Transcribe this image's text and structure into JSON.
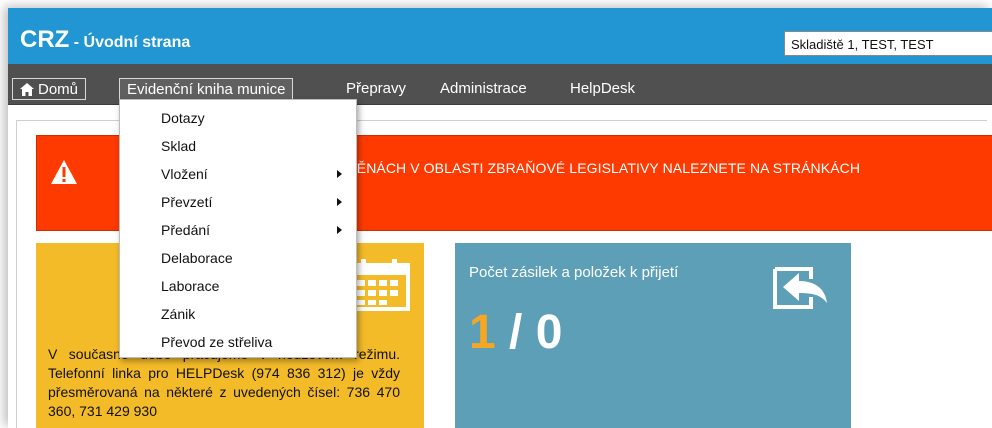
{
  "app": {
    "title_main": "CRZ",
    "title_sub": " - Úvodní strana",
    "storage_selector": "Skladiště 1, TEST, TEST"
  },
  "nav": {
    "home": "Domů",
    "ammo_book": "Evidenční kniha munice",
    "transport": "Přepravy",
    "admin": "Administrace",
    "helpdesk": "HelpDesk"
  },
  "dropdown": {
    "items": [
      {
        "label": "Dotazy"
      },
      {
        "label": "Sklad"
      },
      {
        "label": "Vložení"
      },
      {
        "label": "Převzetí"
      },
      {
        "label": "Předání"
      },
      {
        "label": "Delaborace"
      },
      {
        "label": "Laborace"
      },
      {
        "label": "Zánik"
      },
      {
        "label": "Převod ze střeliva"
      }
    ]
  },
  "alert": {
    "text": "MĚNÁCH V OBLASTI ZBRAŇOVÉ LEGISLATIVY NALEZNETE NA STRÁNKÁCH"
  },
  "yellow_tile": {
    "text": "V současné době pracujeme v nouzovém režimu. Telefonní linka pro HELPDesk (974 836 312) je vždy přesměrovaná na některé z uvedených čísel: 736 470 360, 731 429 930"
  },
  "blue_tile": {
    "title": "Počet zásilek a položek k přijetí",
    "count_shipments": "1",
    "separator": " / ",
    "count_items": "0"
  },
  "colors": {
    "titlebar": "#2196d3",
    "navbar": "#505050",
    "alert": "#ff3a00",
    "yellow_tile": "#f4bb29",
    "blue_tile": "#5e9fb8",
    "accent_orange": "#f5a623"
  }
}
